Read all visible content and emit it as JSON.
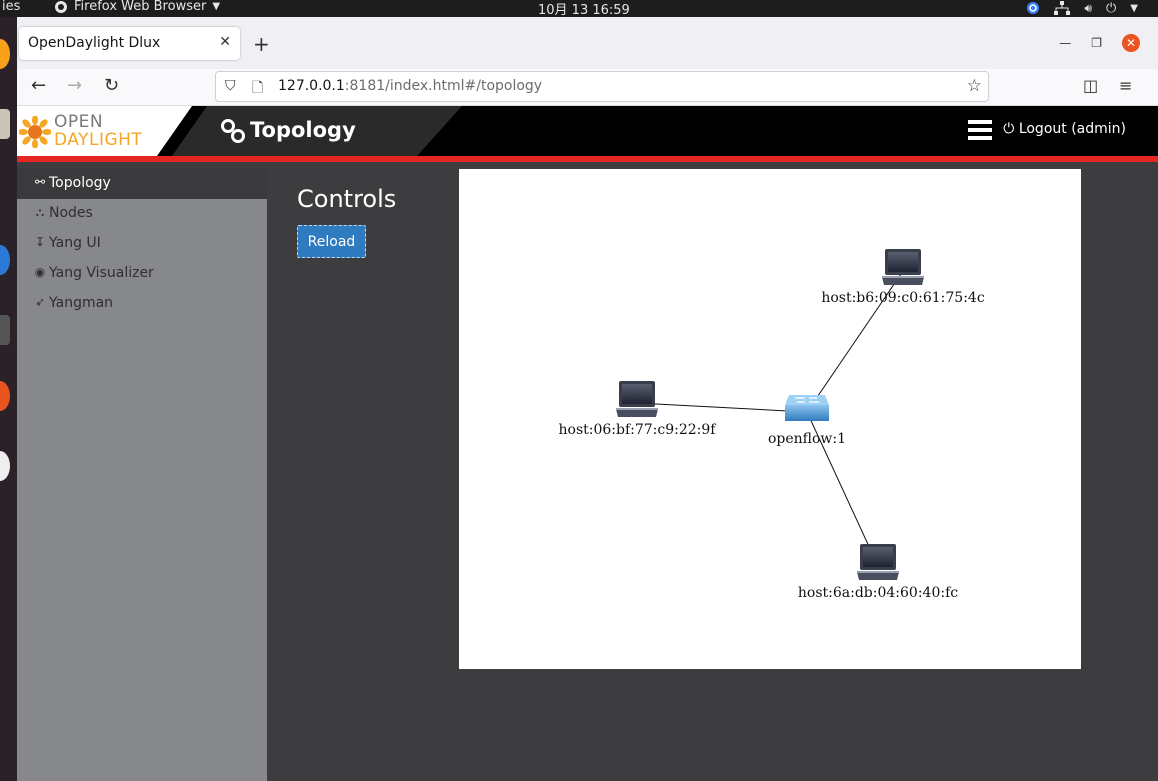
{
  "os": {
    "activities": "ies",
    "app_name": "Firefox Web Browser",
    "clock": "10月 13  16:59"
  },
  "browser": {
    "tab_title": "OpenDaylight Dlux",
    "url_host": "127.0.0.1",
    "url_rest": ":8181/index.html#/topology"
  },
  "header": {
    "logo_line1": "OPEN",
    "logo_line2": "DAYLIGHT",
    "title": "Topology",
    "logout": "Logout (admin)"
  },
  "sidebar": {
    "items": [
      {
        "label": "Topology",
        "icon": "link-icon",
        "glyph": "⚯"
      },
      {
        "label": "Nodes",
        "icon": "sitemap-icon",
        "glyph": "⛬"
      },
      {
        "label": "Yang UI",
        "icon": "level-down-icon",
        "glyph": "↧"
      },
      {
        "label": "Yang Visualizer",
        "icon": "eye-icon",
        "glyph": "◉"
      },
      {
        "label": "Yangman",
        "icon": "rocket-icon",
        "glyph": "➶"
      }
    ]
  },
  "main": {
    "controls_title": "Controls",
    "reload_label": "Reload"
  },
  "topology": {
    "nodes": [
      {
        "id": "sw",
        "label": "openflow:1",
        "type": "switch"
      },
      {
        "id": "h1",
        "label": "host:b6:09:c0:61:75:4c",
        "type": "host"
      },
      {
        "id": "h2",
        "label": "host:06:bf:77:c9:22:9f",
        "type": "host"
      },
      {
        "id": "h3",
        "label": "host:6a:db:04:60:40:fc",
        "type": "host"
      }
    ],
    "links": [
      {
        "source": "sw",
        "target": "h1"
      },
      {
        "source": "sw",
        "target": "h2"
      },
      {
        "source": "sw",
        "target": "h3"
      }
    ]
  },
  "colors": {
    "accent_red": "#e52521",
    "button_blue": "#2f7bbf",
    "logo_orange": "#f5a623"
  }
}
